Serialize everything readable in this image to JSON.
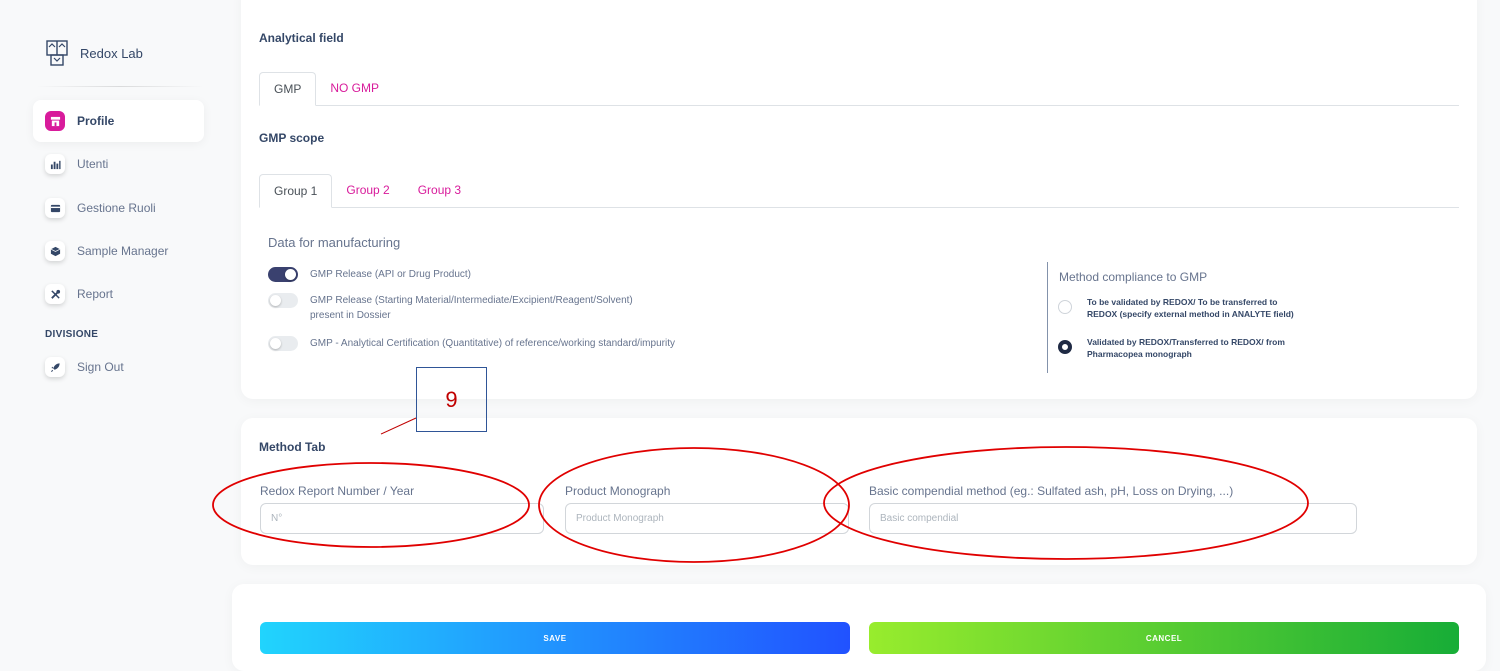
{
  "sidebar": {
    "brand": "Redox Lab",
    "items": [
      {
        "label": "Profile",
        "icon": "store-icon"
      },
      {
        "label": "Utenti",
        "icon": "chart-icon"
      },
      {
        "label": "Gestione Ruoli",
        "icon": "card-icon"
      },
      {
        "label": "Sample Manager",
        "icon": "box-icon"
      },
      {
        "label": "Report",
        "icon": "tools-icon"
      }
    ],
    "section": "DIVISIONE",
    "signout": {
      "label": "Sign Out",
      "icon": "rocket-icon"
    },
    "accent_color": "#d81b9b"
  },
  "analytical": {
    "title": "Analytical field",
    "tabs": [
      "GMP",
      "NO GMP"
    ],
    "scope_title": "GMP scope",
    "group_tabs": [
      "Group 1",
      "Group 2",
      "Group 3"
    ],
    "data_title": "Data for manufacturing",
    "switches": [
      {
        "label": "GMP Release (API or Drug Product)",
        "on": true
      },
      {
        "label": "GMP Release (Starting Material/Intermediate/Excipient/Reagent/Solvent)",
        "label2": "present in Dossier",
        "on": false
      },
      {
        "label": "GMP - Analytical Certification (Quantitative) of reference/working standard/impurity",
        "on": false
      }
    ],
    "compliance": {
      "title": "Method compliance to GMP",
      "options": [
        {
          "line1": "To be validated by REDOX/ To be transferred to",
          "line2": "REDOX (specify external method in ANALYTE field)",
          "checked": false
        },
        {
          "line1": "Validated by REDOX/Transferred to REDOX/ from",
          "line2": "Pharmacopea monograph",
          "checked": true
        }
      ]
    }
  },
  "method": {
    "title": "Method Tab",
    "fields": [
      {
        "label": "Redox Report Number / Year",
        "placeholder": "N°"
      },
      {
        "label": "Product Monograph",
        "placeholder": "Product Monograph"
      },
      {
        "label": "Basic compendial method (eg.: Sulfated ash, pH, Loss on Drying, ...)",
        "placeholder": "Basic compendial"
      }
    ]
  },
  "actions": {
    "save": "SAVE",
    "cancel": "CANCEL"
  },
  "annotation": {
    "number": "9",
    "color": "#c00000"
  }
}
